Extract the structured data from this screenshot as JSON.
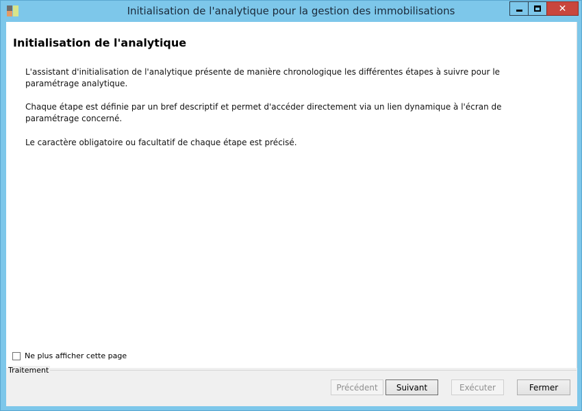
{
  "window": {
    "title": "Initialisation de l'analytique pour la gestion des immobilisations",
    "icon": "app-icon",
    "controls": {
      "minimize_icon": "minimize-icon",
      "maximize_icon": "maximize-icon",
      "close_icon": "close-icon",
      "close_glyph": "✕"
    },
    "accent_color": "#7dc7ea",
    "close_color": "#c9463d"
  },
  "page": {
    "title": "Initialisation de l'analytique",
    "paragraphs": [
      "L'assistant d'initialisation de l'analytique présente de manière chronologique les différentes étapes à suivre pour le paramétrage analytique.",
      "Chaque étape est définie par un bref descriptif et permet d'accéder directement via un lien dynamique à l'écran de paramétrage concerné.",
      "Le caractère obligatoire ou facultatif de chaque étape est précisé."
    ]
  },
  "options": {
    "dont_show_label": "Ne plus afficher cette page",
    "dont_show_checked": false
  },
  "footer": {
    "group_label": "Traitement",
    "buttons": {
      "previous": "Précédent",
      "next": "Suivant",
      "execute": "Exécuter",
      "close": "Fermer"
    }
  }
}
